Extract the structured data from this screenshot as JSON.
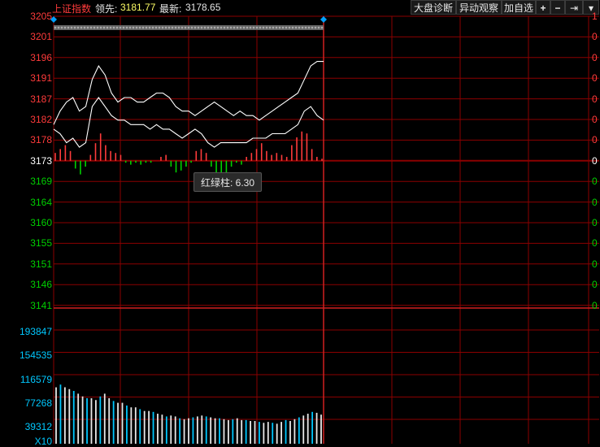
{
  "header": {
    "index_name": "上证指数",
    "leader_label": "领先:",
    "leader_value": "3181.77",
    "latest_label": "最新:",
    "latest_value": "3178.65"
  },
  "toolbar": {
    "diagnosis_button": "大盘诊断",
    "anomaly_button": "异动观察",
    "add_watch_button": "加自选",
    "plus_glyph": "+",
    "minus_glyph": "−",
    "pin_glyph": "⇥",
    "menu_glyph": "▾"
  },
  "price_axis": {
    "labels": [
      "3205",
      "3201",
      "3196",
      "3191",
      "3187",
      "3182",
      "3178",
      "3173",
      "3169",
      "3164",
      "3160",
      "3155",
      "3151",
      "3146",
      "3141"
    ],
    "right_labels": [
      "1",
      "0",
      "0",
      "0",
      "0",
      "0",
      "0",
      "0",
      "0",
      "0",
      "0",
      "0",
      "0",
      "0",
      "0"
    ]
  },
  "volume_axis": {
    "labels": [
      "193847",
      "154535",
      "116579",
      "77268",
      "39312"
    ],
    "unit_label": "X10"
  },
  "tooltip": {
    "label": "红绿柱:",
    "value": "6.30"
  },
  "colors": {
    "red": "#ff3b3b",
    "green": "#00d000",
    "cyan": "#00c8ff",
    "grid": "#8b0000",
    "white": "#ffffff",
    "yellow": "#ffff66"
  },
  "chart_data": {
    "type": "line",
    "ylim": [
      3141,
      3205
    ],
    "baseline": 3173,
    "series": [
      {
        "values": [
          3181,
          3184,
          3186,
          3187,
          3184,
          3185,
          3191,
          3194,
          3192,
          3188,
          3186,
          3187,
          3187,
          3186,
          3186,
          3187,
          3188,
          3188,
          3187,
          3185,
          3184,
          3184,
          3183,
          3184,
          3185,
          3186,
          3185,
          3184,
          3183,
          3184,
          3183,
          3183,
          3182,
          3183,
          3184,
          3185,
          3186,
          3187,
          3188,
          3191,
          3194,
          3195,
          3195
        ]
      },
      {
        "values": [
          3180,
          3179,
          3177,
          3178,
          3176,
          3177,
          3185,
          3187,
          3185,
          3183,
          3182,
          3182,
          3181,
          3181,
          3181,
          3180,
          3181,
          3180,
          3180,
          3179,
          3178,
          3179,
          3180,
          3179,
          3177,
          3176,
          3177,
          3177,
          3177,
          3177,
          3177,
          3178,
          3178,
          3178,
          3179,
          3179,
          3179,
          3180,
          3181,
          3184,
          3185,
          3183,
          3182
        ]
      }
    ],
    "macd_bars": [
      4,
      6,
      8,
      5,
      -4,
      -7,
      -3,
      3,
      9,
      14,
      8,
      5,
      4,
      3,
      -1,
      -2,
      -1,
      -2,
      -1,
      -1,
      0,
      2,
      3,
      -3,
      -6,
      -5,
      -3,
      -1,
      5,
      6,
      4,
      -3,
      -9,
      -8,
      -6,
      -3,
      -1,
      -2,
      2,
      4,
      6,
      9,
      5,
      3,
      4,
      3,
      2,
      8,
      12,
      15,
      14,
      6,
      2,
      1
    ],
    "volume_bars": [
      62,
      65,
      62,
      60,
      58,
      55,
      52,
      50,
      50,
      48,
      52,
      55,
      50,
      47,
      45,
      45,
      42,
      40,
      40,
      38,
      36,
      36,
      35,
      33,
      32,
      30,
      31,
      30,
      28,
      27,
      28,
      29,
      30,
      31,
      30,
      29,
      28,
      28,
      27,
      26,
      27,
      28,
      26,
      26,
      25,
      25,
      24,
      23,
      24,
      23,
      22,
      24,
      26,
      25,
      27,
      29,
      31,
      33,
      35,
      34,
      32
    ]
  }
}
